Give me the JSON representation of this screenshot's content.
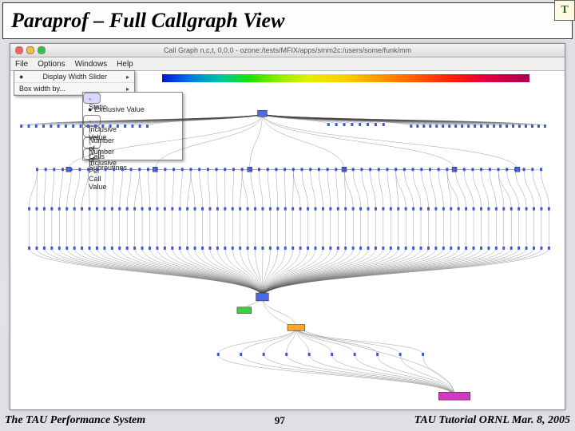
{
  "slide": {
    "title": "Paraprof – Full Callgraph View",
    "badge": "T"
  },
  "window": {
    "title": "Call Graph n,c,t, 0,0,0 - ozone:/tests/MFIX/apps/smm2c:/users/some/funk/mm",
    "menus": [
      "File",
      "Options",
      "Windows",
      "Help"
    ]
  },
  "dropdown": {
    "row1": "Display Width Slider",
    "row2": "Box width by..."
  },
  "popup": {
    "items": [
      "Static",
      "Exclusive Value",
      "Inclusive Value",
      "Number of Calls",
      "Number of Subroutines",
      "Inclusive Per Call Value"
    ]
  },
  "footer": {
    "left": "The TAU Performance System",
    "page": "97",
    "right": "TAU Tutorial ORNL Mar. 8, 2005"
  }
}
